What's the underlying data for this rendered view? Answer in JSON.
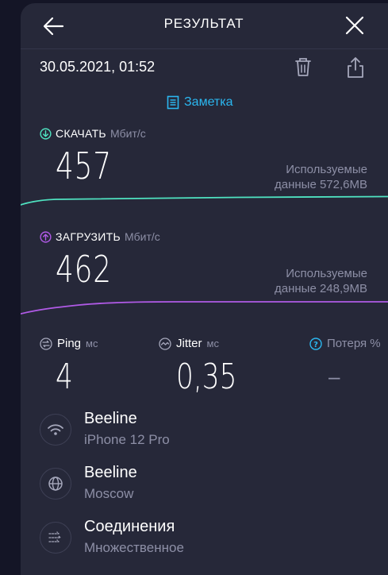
{
  "header": {
    "title": "РЕЗУЛЬТАТ",
    "back_icon": "arrow-left-icon",
    "close_icon": "close-icon"
  },
  "result": {
    "datetime": "30.05.2021, 01:52",
    "note_label": "Заметка"
  },
  "download": {
    "label": "СКАЧАТЬ",
    "unit": "Мбит/с",
    "value": "457",
    "used_line1": "Используемые",
    "used_line2": "данные 572,6MB",
    "color": "#4fe3c1"
  },
  "upload": {
    "label": "ЗАГРУЗИТЬ",
    "unit": "Мбит/с",
    "value": "462",
    "used_line1": "Используемые",
    "used_line2": "данные 248,9MB",
    "color": "#b05ae6"
  },
  "ping": {
    "label": "Ping",
    "unit": "мс",
    "value": "4"
  },
  "jitter": {
    "label": "Jitter",
    "unit": "мс",
    "value": "0,35"
  },
  "loss": {
    "label": "Потеря %",
    "value": "–"
  },
  "rows": [
    {
      "icon": "wifi-icon",
      "title": "Beeline",
      "subtitle": "iPhone 12 Pro"
    },
    {
      "icon": "globe-icon",
      "title": "Beeline",
      "subtitle": "Moscow"
    },
    {
      "icon": "connections-icon",
      "title": "Соединения",
      "subtitle": "Множественное"
    }
  ],
  "colors": {
    "accent": "#2bb7f0",
    "background": "#262839"
  }
}
